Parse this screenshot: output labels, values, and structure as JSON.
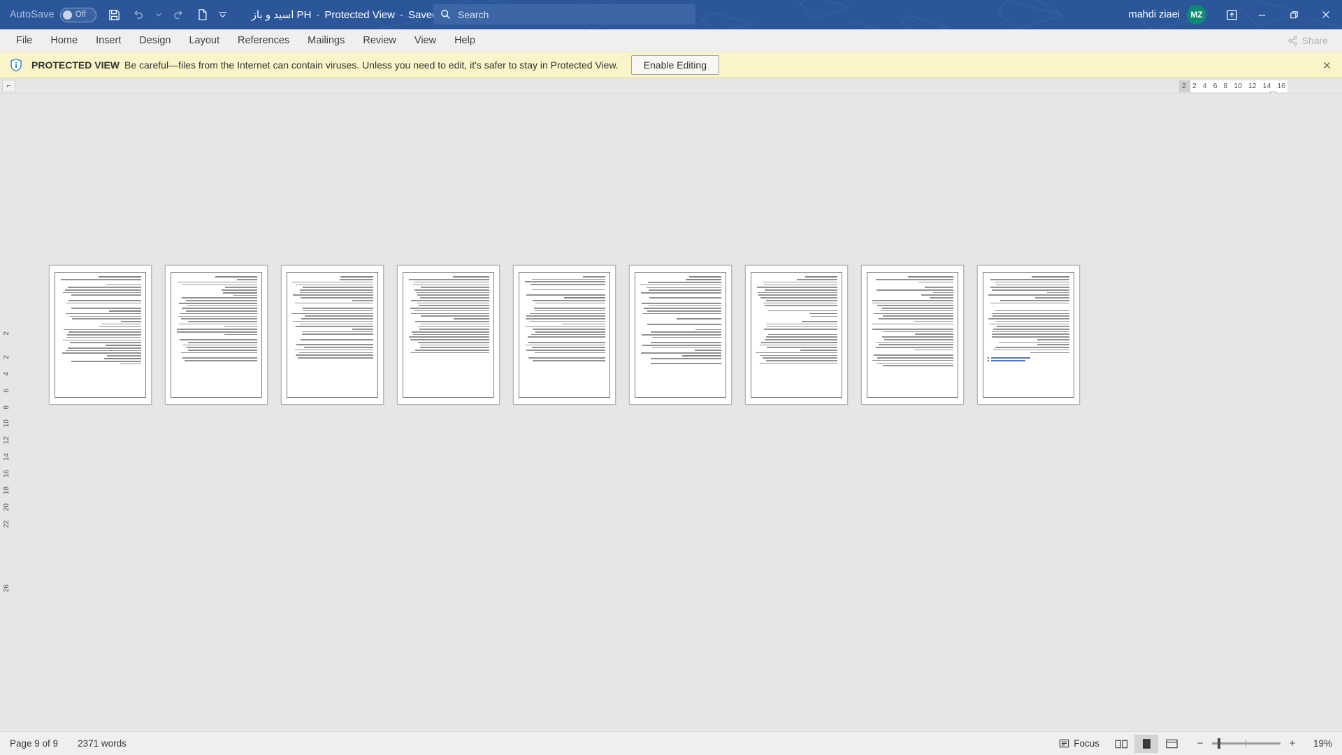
{
  "titlebar": {
    "autosave_label": "AutoSave",
    "autosave_state": "Off",
    "save_icon": "save-icon",
    "undo_icon": "undo-icon",
    "redo_icon": "redo-icon",
    "new_icon": "new-document-icon",
    "customize_icon": "customize-quick-access-toolbar-icon",
    "doc_title": "اسید و باز PH",
    "protected_view": "Protected View",
    "saved_location": "Saved to this PC",
    "separator": "-",
    "search_placeholder": "Search",
    "search_icon": "search-icon",
    "username": "mahdi ziaei",
    "avatar_initials": "MZ",
    "ribbon_display_icon": "ribbon-display-options-icon",
    "minimize_icon": "minimize-icon",
    "restore_icon": "restore-icon",
    "close_icon": "close-icon",
    "accent_color": "#2b579a",
    "avatar_color": "#0f8a72"
  },
  "ribbon": {
    "tabs": [
      {
        "label": "File"
      },
      {
        "label": "Home"
      },
      {
        "label": "Insert"
      },
      {
        "label": "Design"
      },
      {
        "label": "Layout"
      },
      {
        "label": "References"
      },
      {
        "label": "Mailings"
      },
      {
        "label": "Review"
      },
      {
        "label": "View"
      },
      {
        "label": "Help"
      }
    ],
    "share_label": "Share",
    "share_icon": "share-icon"
  },
  "protected_view": {
    "icon": "info-shield-icon",
    "title": "PROTECTED VIEW",
    "message": "Be careful—files from the Internet can contain viruses. Unless you need to edit, it's safer to stay in Protected View.",
    "enable_button": "Enable Editing",
    "close_icon": "close-icon",
    "banner_color": "#faf5c8"
  },
  "ruler": {
    "tab_selector_icon": "left-tab-stop-icon",
    "left_marks": [
      "2"
    ],
    "marks": [
      "2",
      "4",
      "6",
      "8",
      "10",
      "12",
      "14",
      "16"
    ],
    "vertical_marks": [
      "2",
      "2",
      "4",
      "6",
      "8",
      "10",
      "12",
      "14",
      "16",
      "18",
      "20",
      "22",
      "26"
    ]
  },
  "document": {
    "pages": [
      {
        "number": 1,
        "lines": 34,
        "has_links": false
      },
      {
        "number": 2,
        "lines": 33,
        "has_links": false
      },
      {
        "number": 3,
        "lines": 32,
        "has_links": false
      },
      {
        "number": 4,
        "lines": 30,
        "has_links": false
      },
      {
        "number": 5,
        "lines": 33,
        "has_links": false
      },
      {
        "number": 6,
        "lines": 34,
        "has_links": false
      },
      {
        "number": 7,
        "lines": 34,
        "has_links": false
      },
      {
        "number": 8,
        "lines": 35,
        "has_links": false
      },
      {
        "number": 9,
        "lines": 30,
        "has_links": true
      }
    ],
    "link_items": [
      "https://www.zistonline.com",
      "https://bhp.beyhaghi.ir"
    ]
  },
  "statusbar": {
    "page_info": "Page 9 of 9",
    "word_count": "2371 words",
    "focus_label": "Focus",
    "focus_icon": "focus-mode-icon",
    "view_read_icon": "read-mode-icon",
    "view_print_icon": "print-layout-icon",
    "view_web_icon": "web-layout-icon",
    "zoom_out_icon": "zoom-out-icon",
    "zoom_in_icon": "zoom-in-icon",
    "zoom_level": "19%"
  }
}
